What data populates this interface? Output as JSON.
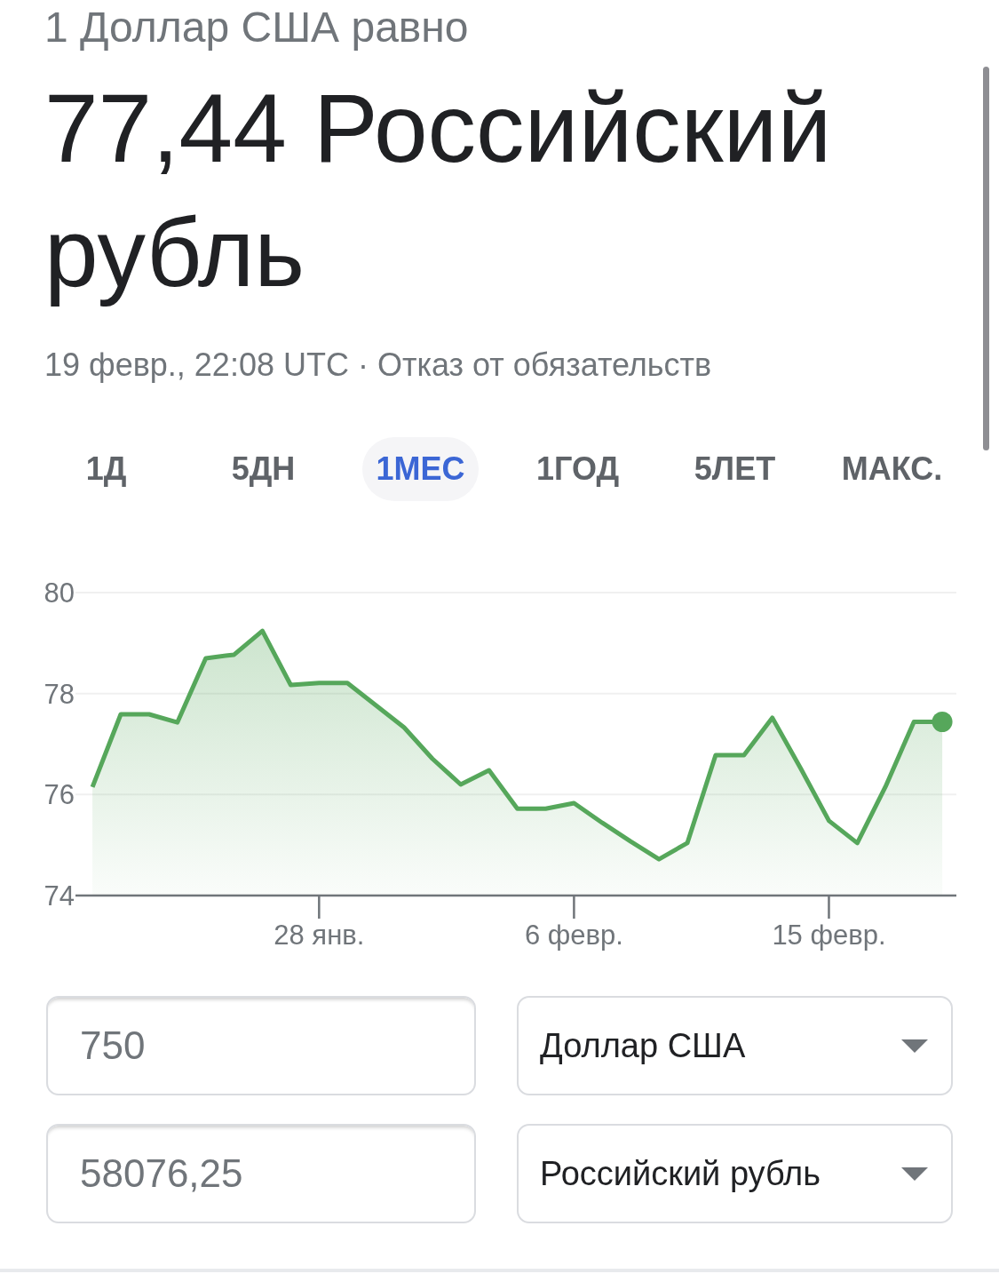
{
  "header": {
    "intro": "1 Доллар США равно",
    "result": "77,44 Российский рубль",
    "timestamp": "19 февр., 22:08 UTC",
    "separator": "·",
    "disclaimer_link": "Отказ от обязательств"
  },
  "range_tabs": [
    {
      "label": "1Д",
      "selected": false
    },
    {
      "label": "5ДН",
      "selected": false
    },
    {
      "label": "1МЕС",
      "selected": true
    },
    {
      "label": "1ГОД",
      "selected": false
    },
    {
      "label": "5ЛЕТ",
      "selected": false
    },
    {
      "label": "МАКС.",
      "selected": false
    }
  ],
  "chart": {
    "chart_data": {
      "type": "area",
      "categories": [
        null,
        null,
        null,
        null,
        null,
        null,
        null,
        null,
        "28 янв.",
        null,
        null,
        null,
        null,
        null,
        null,
        null,
        null,
        "6 февр.",
        null,
        null,
        null,
        null,
        null,
        null,
        null,
        null,
        "15 февр.",
        null,
        null,
        null,
        null
      ],
      "series": [
        {
          "color": "#56a75b",
          "values": [
            76.15,
            77.59,
            77.59,
            77.43,
            78.7,
            78.77,
            79.24,
            78.17,
            78.21,
            78.21,
            77.77,
            77.33,
            76.71,
            76.2,
            76.48,
            75.72,
            75.72,
            75.83,
            75.44,
            75.07,
            74.72,
            75.04,
            76.78,
            76.78,
            77.52,
            76.52,
            75.48,
            75.04,
            76.16,
            77.44,
            77.44
          ]
        }
      ],
      "ylim": [
        74,
        80
      ],
      "yticks": [
        74,
        76,
        78,
        80
      ]
    }
  },
  "converter": {
    "rows": [
      {
        "amount": "750",
        "currency": "Доллар США"
      },
      {
        "amount": "58076,25",
        "currency": "Российский рубль"
      }
    ]
  }
}
